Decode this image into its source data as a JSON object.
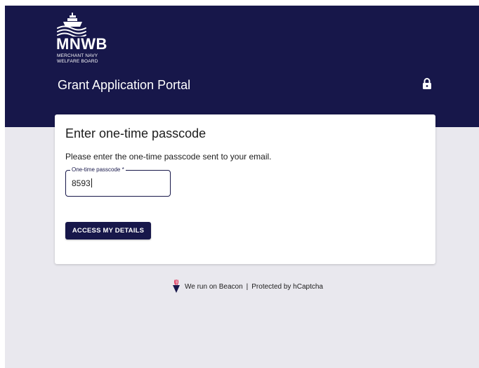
{
  "brand": {
    "abbr": "MNWB",
    "name_line1": "MERCHANT NAVY",
    "name_line2": "WELFARE BOARD",
    "logo_icon": "ship-on-waves-icon"
  },
  "header": {
    "title": "Grant Application Portal",
    "lock_icon": "lock-icon"
  },
  "card": {
    "title": "Enter one-time passcode",
    "instruction": "Please enter the one-time passcode sent to your email.",
    "otp_field": {
      "label": "One-time passcode *",
      "value": "8593"
    },
    "submit_label": "ACCESS MY DETAILS"
  },
  "footer": {
    "beacon_icon": "beacon-torch-icon",
    "beacon_text": "We run on Beacon",
    "separator": "|",
    "captcha_text": "Protected by hCaptcha"
  },
  "colors": {
    "brand_navy": "#17174a",
    "page_background": "#e9e8ee",
    "card_background": "#ffffff",
    "beacon_red": "#e0224b"
  }
}
